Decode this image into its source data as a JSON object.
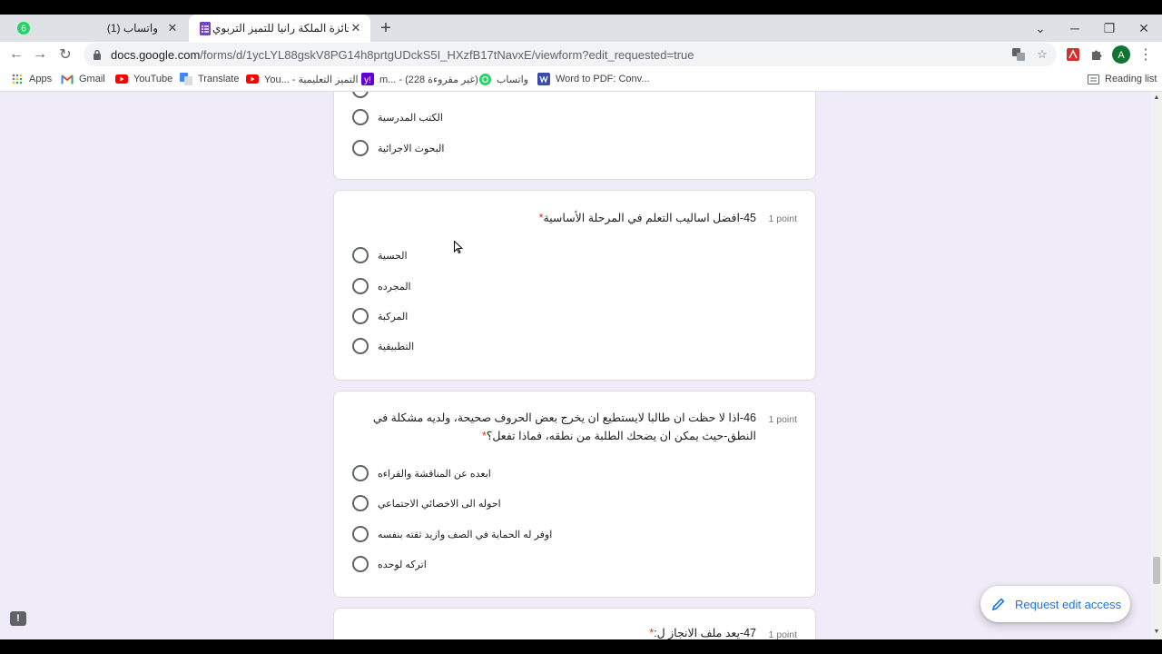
{
  "browser": {
    "tabs": [
      {
        "title": "(1) واتساب",
        "badge": "6"
      },
      {
        "title": "جائزة الملكة رانيا للتميز التربوي"
      }
    ],
    "url_host": "docs.google.com",
    "url_rest": "/forms/d/1ycLYL88gskV8PG14h8prtgUDckS5I_HXzfB17tNavxE/viewform?edit_requested=true",
    "profile_initial": "A",
    "bookmarks": [
      {
        "label": "Apps",
        "icon": "apps-grid-icon"
      },
      {
        "label": "Gmail",
        "icon": "gmail-icon"
      },
      {
        "label": "YouTube",
        "icon": "youtube-icon"
      },
      {
        "label": "Translate",
        "icon": "translate-icon"
      },
      {
        "label": "You... - التميز التعليمية",
        "icon": "youtube-icon"
      },
      {
        "label": "m... - (228 غير مقروءة)",
        "icon": "yahoo-mail-icon"
      },
      {
        "label": "واتساب",
        "icon": "whatsapp-icon"
      },
      {
        "label": "Word to PDF: Conv...",
        "icon": "word-to-pdf-icon"
      }
    ],
    "reading_list": "Reading list"
  },
  "form": {
    "prev_question_options": [
      "الكتب المدرسية",
      "البحوث الاجرائية"
    ],
    "questions": [
      {
        "title": "45-افضل اساليب التعلم في المرحلة الأساسية",
        "required_mark": "*",
        "points": "1 point",
        "options": [
          "الحسية",
          "المجرده",
          "المركبة",
          "التطبيقية"
        ]
      },
      {
        "title": "46-اذا لا حظت ان طالبا لايستطيع ان يخرج بعض الحروف صحيحة، ولديه مشكلة في النطق-حيث يمكن ان يضحك الطلبة من نطقه، فماذا تفعل؟",
        "required_mark": "*",
        "points": "1 point",
        "options": [
          "ابعده عن المناقشة والقراءه",
          "احوله الى الاخصائي الاجتماعي",
          "اوفر له الحماية في الصف وازيد ثقته بنفسه",
          "اتركه لوحده"
        ]
      },
      {
        "title": "47-يعد ملف الانجاز ل:",
        "required_mark": "*",
        "points": "1 point"
      }
    ],
    "request_edit_label": "Request edit access",
    "feedback_icon_text": "!"
  },
  "colors": {
    "form_background": "#f0ebf8",
    "accent": "#1a73e8",
    "required": "#d93025"
  }
}
